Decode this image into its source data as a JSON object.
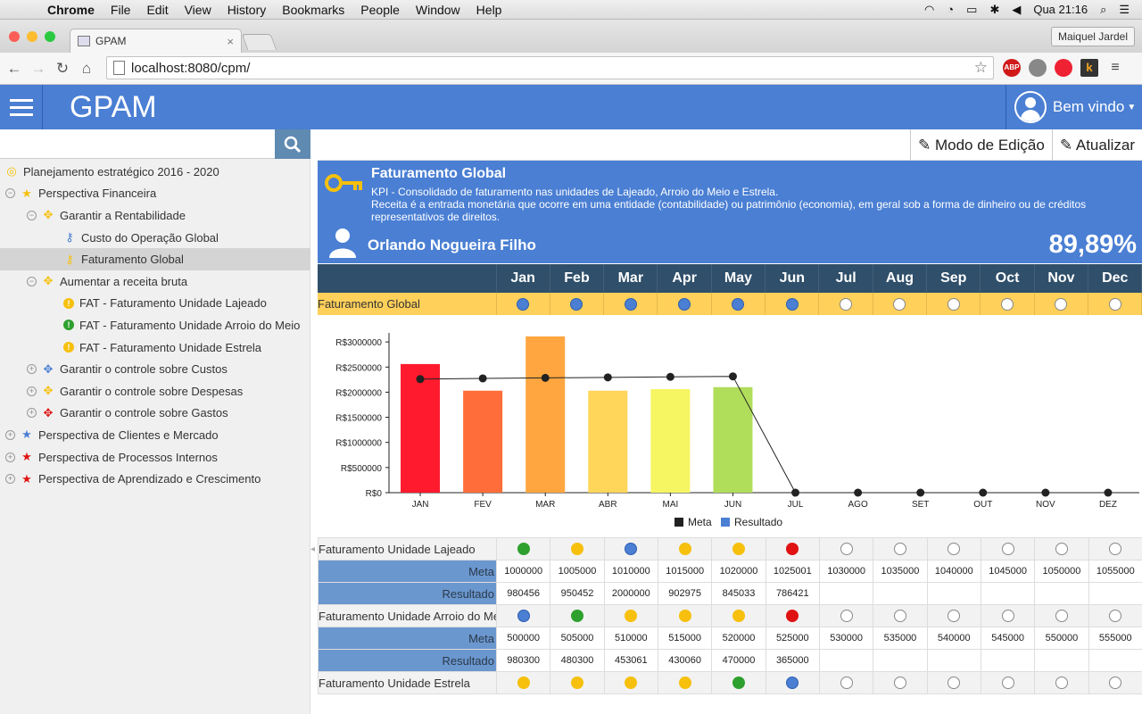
{
  "os_menu": {
    "app": "Chrome",
    "items": [
      "File",
      "Edit",
      "View",
      "History",
      "Bookmarks",
      "People",
      "Window",
      "Help"
    ],
    "clock": "Qua 21:16"
  },
  "browser": {
    "tab_title": "GPAM",
    "profile": "Maiquel Jardel",
    "url": "localhost:8080/cpm/"
  },
  "app": {
    "brand": "GPAM",
    "user_greeting": "Bem vindo",
    "search_placeholder": "",
    "toolbar": {
      "edit_mode": "Modo de Edição",
      "refresh": "Atualizar"
    }
  },
  "tree": [
    {
      "label": "Planejamento estratégico 2016 - 2020",
      "icon": "target-icon",
      "color": "#f0c000",
      "depth": 0
    },
    {
      "label": "Perspectiva Financeira",
      "icon": "star-icon",
      "color": "#f6c00c",
      "depth": 0
    },
    {
      "label": "Garantir a Rentabilidade",
      "icon": "crosshair-icon",
      "color": "#f6c00c",
      "depth": 1
    },
    {
      "label": "Custo do Operação Global",
      "icon": "key-icon",
      "color": "#4a7fd3",
      "depth": 2
    },
    {
      "label": "Faturamento Global",
      "icon": "key-icon",
      "color": "#f6c00c",
      "depth": 2
    },
    {
      "label": "Aumentar a receita bruta",
      "icon": "crosshair-icon",
      "color": "#f6c00c",
      "depth": 1
    },
    {
      "label": "FAT - Faturamento Unidade Lajeado",
      "icon": "alert-icon",
      "color": "#f6c00c",
      "depth": 2
    },
    {
      "label": "FAT - Faturamento Unidade Arroio do Meio",
      "icon": "alert-icon",
      "color": "#2ea02e",
      "depth": 2
    },
    {
      "label": "FAT - Faturamento Unidade Estrela",
      "icon": "alert-icon",
      "color": "#f6c00c",
      "depth": 2
    },
    {
      "label": "Garantir o controle sobre Custos",
      "icon": "crosshair-icon",
      "color": "#4a7fd3",
      "depth": 1
    },
    {
      "label": "Garantir o controle sobre Despesas",
      "icon": "crosshair-icon",
      "color": "#f6c00c",
      "depth": 1
    },
    {
      "label": "Garantir o controle sobre Gastos",
      "icon": "crosshair-icon",
      "color": "#e01212",
      "depth": 1
    },
    {
      "label": "Perspectiva de Clientes e Mercado",
      "icon": "star-icon",
      "color": "#4a7fd3",
      "depth": 0
    },
    {
      "label": "Perspectiva de Processos Internos",
      "icon": "star-icon",
      "color": "#e01212",
      "depth": 0
    },
    {
      "label": "Perspectiva de Aprendizado e Crescimento",
      "icon": "star-icon",
      "color": "#e01212",
      "depth": 0
    }
  ],
  "kpi": {
    "title": "Faturamento Global",
    "desc_line1": "KPI - Consolidado de faturamento nas unidades de Lajeado, Arroio do Meio e Estrela.",
    "desc_line2": "Receita é a entrada monetária que ocorre em uma entidade (contabilidade) ou patrimônio (economia), em geral sob a forma de dinheiro ou de créditos representativos de direitos.",
    "owner": "Orlando Nogueira Filho",
    "percent": "89,89%"
  },
  "months": [
    "Jan",
    "Feb",
    "Mar",
    "Apr",
    "May",
    "Jun",
    "Jul",
    "Aug",
    "Sep",
    "Oct",
    "Nov",
    "Dec"
  ],
  "main_row": {
    "label": "Faturamento Global",
    "status": [
      "blue",
      "blue",
      "blue",
      "blue",
      "blue",
      "blue",
      "empty",
      "empty",
      "empty",
      "empty",
      "empty",
      "empty"
    ]
  },
  "chart_data": {
    "type": "bar",
    "categories": [
      "JAN",
      "FEV",
      "MAR",
      "ABR",
      "MAI",
      "JUN",
      "JUL",
      "AGO",
      "SET",
      "OUT",
      "NOV",
      "DEZ"
    ],
    "series": [
      {
        "name": "Resultado",
        "type": "bar",
        "values": [
          2560000,
          2030000,
          3110000,
          2030000,
          2060000,
          2100000,
          0,
          0,
          0,
          0,
          0,
          0
        ],
        "colors": [
          "#ff1a2e",
          "#ff6e3a",
          "#ffa640",
          "#ffd55a",
          "#f6f562",
          "#b0dd5a",
          "#ffffff",
          "#ffffff",
          "#ffffff",
          "#ffffff",
          "#ffffff",
          "#ffffff"
        ]
      },
      {
        "name": "Meta",
        "type": "line",
        "values": [
          2260000,
          2275000,
          2285000,
          2295000,
          2305000,
          2315000,
          0,
          0,
          0,
          0,
          0,
          0
        ]
      }
    ],
    "ylim": [
      0,
      3000000
    ],
    "yticks": [
      0,
      500000,
      1000000,
      1500000,
      2000000,
      2500000,
      3000000
    ],
    "ytick_labels": [
      "R$0",
      "R$500000",
      "R$1000000",
      "R$1500000",
      "R$2000000",
      "R$2500000",
      "R$3000000"
    ],
    "legend": [
      {
        "name": "Meta",
        "color": "#222222"
      },
      {
        "name": "Resultado",
        "color": "#4a7fd3"
      }
    ]
  },
  "units": [
    {
      "label": "Faturamento Unidade Lajeado",
      "status": [
        "green",
        "yellow",
        "blue",
        "yellow",
        "yellow",
        "red",
        "empty",
        "empty",
        "empty",
        "empty",
        "empty",
        "empty"
      ],
      "meta_label": "Meta",
      "meta": [
        "1000000",
        "1005000",
        "1010000",
        "1015000",
        "1020000",
        "1025001",
        "1030000",
        "1035000",
        "1040000",
        "1045000",
        "1050000",
        "1055000"
      ],
      "result_label": "Resultado",
      "result": [
        "980456",
        "950452",
        "2000000",
        "902975",
        "845033",
        "786421",
        "",
        "",
        "",
        "",
        "",
        ""
      ]
    },
    {
      "label": "Faturamento Unidade Arroio do Meio",
      "status": [
        "blue",
        "green",
        "yellow",
        "yellow",
        "yellow",
        "red",
        "empty",
        "empty",
        "empty",
        "empty",
        "empty",
        "empty"
      ],
      "meta_label": "Meta",
      "meta": [
        "500000",
        "505000",
        "510000",
        "515000",
        "520000",
        "525000",
        "530000",
        "535000",
        "540000",
        "545000",
        "550000",
        "555000"
      ],
      "result_label": "Resultado",
      "result": [
        "980300",
        "480300",
        "453061",
        "430060",
        "470000",
        "365000",
        "",
        "",
        "",
        "",
        "",
        ""
      ]
    },
    {
      "label": "Faturamento Unidade Estrela",
      "status": [
        "yellow",
        "yellow",
        "yellow",
        "yellow",
        "green",
        "blue",
        "empty",
        "empty",
        "empty",
        "empty",
        "empty",
        "empty"
      ]
    }
  ]
}
